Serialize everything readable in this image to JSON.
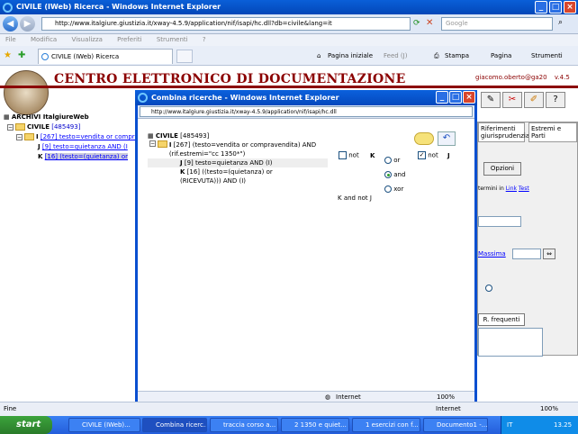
{
  "window": {
    "title": "CIVILE (IWeb) Ricerca - Windows Internet Explorer"
  },
  "address": {
    "url": "http://www.italgiure.giustizia.it/xway-4.5.9/application/nif/isapi/hc.dll?db=civile&lang=it",
    "search_placeholder": "Google"
  },
  "menu": [
    "File",
    "Modifica",
    "Visualizza",
    "Preferiti",
    "Strumenti",
    "?"
  ],
  "tab": {
    "label": "CIVILE (IWeb) Ricerca"
  },
  "commands": {
    "home": "Pagina iniziale",
    "feed": "Feed (J)",
    "print": "Stampa",
    "page": "Pagina",
    "tools": "Strumenti"
  },
  "header": {
    "title": "CENTRO ELETTRONICO DI DOCUMENTAZIONE",
    "user": "giacomo.oberto@ga20",
    "version": "v.4.5"
  },
  "left_tree": {
    "root": "ARCHIVI ItalgiureWeb",
    "archive": "CIVILE",
    "archive_count": "[485493]",
    "i_label": "I",
    "i_link": "[267] testo=vendita or compra",
    "j_label": "J",
    "j_link": "[9] testo=quietanza AND (I",
    "k_label": "K",
    "k_link": "[16] (testo=(quietanza) or"
  },
  "right_panel": {
    "tab1": "Riferimenti giurisprudenziali",
    "tab2": "Estremi e Parti",
    "options": "Opzioni",
    "termini": "termini in",
    "link": "Link",
    "test": "Test",
    "massima": "Massima",
    "frequenti": "R. frequenti"
  },
  "popup": {
    "title": "Combina ricerche - Windows Internet Explorer",
    "url": "http://www.italgiure.giustizia.it/xway-4.5.9/application/nif/isapi/hc.dll",
    "archive": "CIVILE",
    "archive_count": "[485493]",
    "i_label": "I",
    "i_text": "[267] (testo=vendita or compravendita) AND (rif.estremi=\"cc 1350*\")",
    "j_label": "J",
    "j_text": "[9] testo=quietanza AND (I)",
    "k_label": "K",
    "k_text": "[16] ((testo=(quietanza) or (RICEVUTA))) AND (I)",
    "not_left": "not",
    "left_operand": "K",
    "ops": [
      "or",
      "and",
      "xor"
    ],
    "selected_op": "and",
    "not_right": "not",
    "right_operand": "J",
    "expression": "K and not J",
    "status": "Internet",
    "zoom": "100%"
  },
  "status": {
    "left": "Fine",
    "zone": "Internet",
    "zoom": "100%"
  },
  "taskbar": {
    "start": "start",
    "buttons": [
      "CIVILE (IWeb)...",
      "Combina ricerc...",
      "traccia corso a...",
      "2 1350 e quiet...",
      "1 esercizi con f...",
      "Documento1 -..."
    ],
    "lang": "IT",
    "clock": "13.25"
  }
}
